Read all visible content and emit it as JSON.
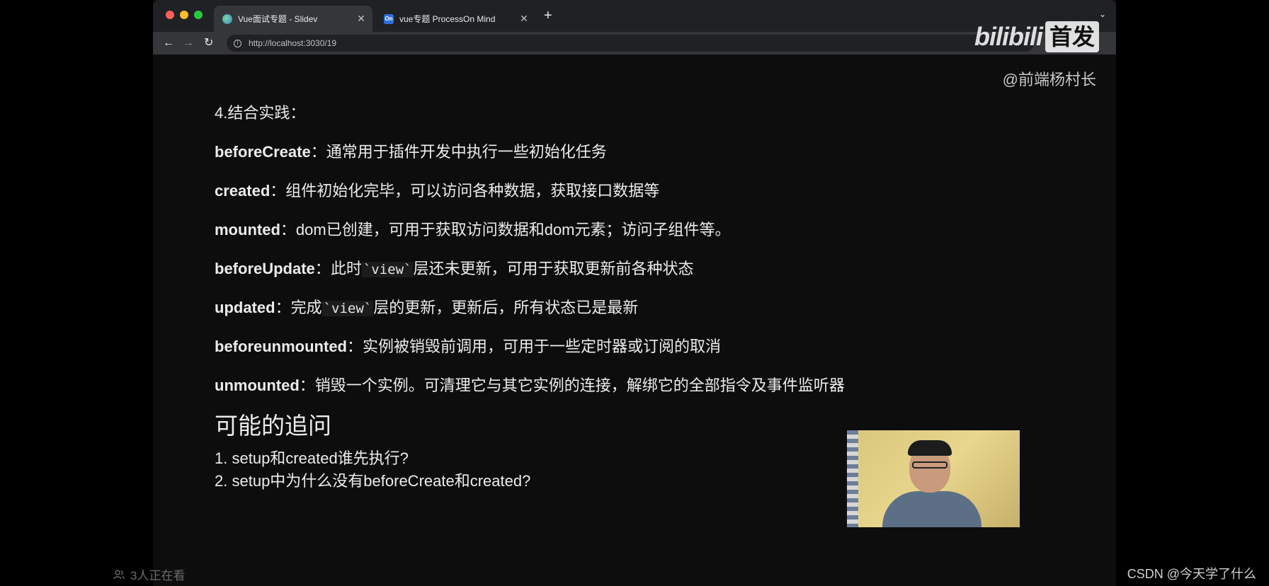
{
  "browser": {
    "tabs": [
      {
        "title": "Vue面试专题 - Slidev",
        "active": true,
        "icon": "slidev-icon"
      },
      {
        "title": "vue专题 ProcessOn Mind",
        "active": false,
        "icon": "processon-icon",
        "icon_text": "On"
      }
    ],
    "url": "http://localhost:3030/19"
  },
  "watermark": {
    "brand": "bilibili",
    "badge": "首发",
    "author": "@前端杨村长"
  },
  "slide": {
    "heading": "4.结合实践：",
    "hooks": [
      {
        "term": "beforeCreate",
        "sep": "：",
        "desc": "通常用于插件开发中执行一些初始化任务"
      },
      {
        "term": "created",
        "sep": "：",
        "desc": "组件初始化完毕，可以访问各种数据，获取接口数据等"
      },
      {
        "term": "mounted",
        "sep": "：",
        "desc": "dom已创建，可用于获取访问数据和dom元素；访问子组件等。"
      },
      {
        "term": "beforeUpdate",
        "sep": "：",
        "pre": "此时",
        "code": "`view`",
        "post": "层还未更新，可用于获取更新前各种状态"
      },
      {
        "term": "updated",
        "sep": "：",
        "pre": "完成",
        "code": "`view`",
        "post": "层的更新，更新后，所有状态已是最新"
      },
      {
        "term": "beforeunmounted",
        "sep": "：",
        "desc": "实例被销毁前调用，可用于一些定时器或订阅的取消"
      },
      {
        "term": "unmounted",
        "sep": "：",
        "desc": "销毁一个实例。可清理它与其它实例的连接，解绑它的全部指令及事件监听器"
      }
    ],
    "followup_title": "可能的追问",
    "followups": [
      {
        "num": "1.",
        "text": "setup和created谁先执行?"
      },
      {
        "num": "2.",
        "text": "setup中为什么没有beforeCreate和created?"
      }
    ]
  },
  "overlay": {
    "viewers": "3人正在看",
    "csdn": "CSDN @今天学了什么"
  }
}
